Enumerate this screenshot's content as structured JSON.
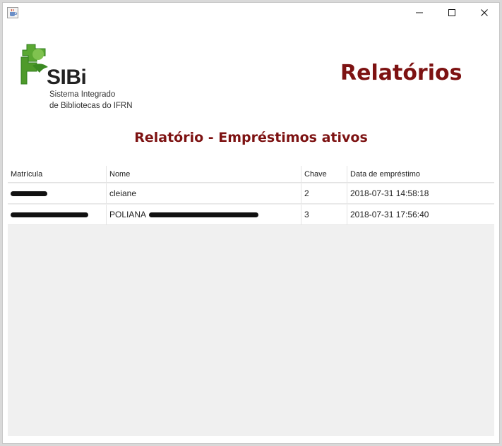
{
  "window": {
    "icon": "java-cup-icon",
    "controls": {
      "minimize": "minimize-icon",
      "maximize": "maximize-icon",
      "close": "close-icon"
    }
  },
  "logo": {
    "name": "SIBi",
    "subtitle_line1": "Sistema Integrado",
    "subtitle_line2": "de Bibliotecas do IFRN",
    "green": "#5aa832",
    "dark_green": "#2f7d1e"
  },
  "header": {
    "title": "Relatórios",
    "color": "#7d1212"
  },
  "report": {
    "title": "Relatório - Empréstimos ativos"
  },
  "table": {
    "columns": [
      "Matrícula",
      "Nome",
      "Chave",
      "Data de empréstimo"
    ],
    "rows": [
      {
        "matricula": "",
        "nome": "cleiane",
        "chave": "2",
        "data": "2018-07-31 14:58:18"
      },
      {
        "matricula": "",
        "nome": "POLIANA",
        "chave": "3",
        "data": "2018-07-31 17:56:40"
      }
    ]
  }
}
